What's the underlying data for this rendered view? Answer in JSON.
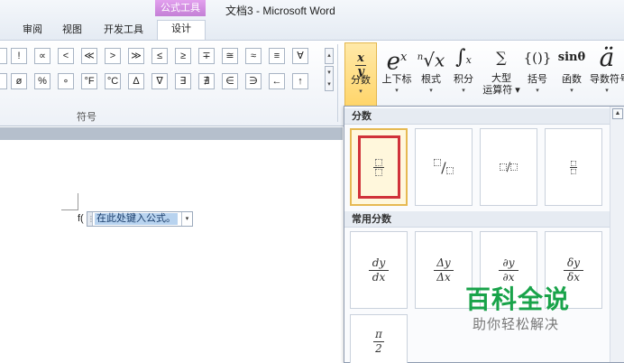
{
  "titlebar": {
    "context_group": "公式工具",
    "doc_title": "文档3 - Microsoft Word",
    "tabs": [
      "审阅",
      "视图",
      "开发工具",
      "设计"
    ]
  },
  "symbols": {
    "row1": [
      "!",
      "∝",
      "<",
      "≪",
      ">",
      "≫",
      "≤",
      "≥",
      "∓",
      "≅",
      "≈",
      "≡",
      "∀"
    ],
    "row2": [
      "ø",
      "%",
      "∘",
      "°F",
      "°C",
      "∆",
      "∇",
      "∃",
      "∄",
      "∈",
      "∋",
      "←",
      "↑"
    ],
    "group_label": "符号"
  },
  "structures": [
    {
      "icon": "x⁄y",
      "label": "分数"
    },
    {
      "icon": "eˣ",
      "label": "上下标"
    },
    {
      "icon": "ⁿ√x",
      "label": "根式"
    },
    {
      "icon": "∫",
      "label": "积分"
    },
    {
      "icon": "∑",
      "label": "大型\n运算符"
    },
    {
      "icon": "{()}",
      "label": "括号"
    },
    {
      "icon": "sinθ",
      "label": "函数"
    },
    {
      "icon": "ä",
      "label": "导数符号"
    }
  ],
  "document": {
    "function_prefix": "f(",
    "equation_placeholder": "在此处键入公式。"
  },
  "gallery": {
    "section1_title": "分数",
    "section2_title": "常用分数",
    "common": [
      {
        "num": "dy",
        "den": "dx"
      },
      {
        "num": "Δy",
        "den": "Δx"
      },
      {
        "num": "∂y",
        "den": "∂x"
      },
      {
        "num": "δy",
        "den": "δx"
      }
    ],
    "last": {
      "num": "π",
      "den": "2"
    }
  },
  "watermark": {
    "title": "百科全说",
    "subtitle": "助你轻松解决"
  }
}
